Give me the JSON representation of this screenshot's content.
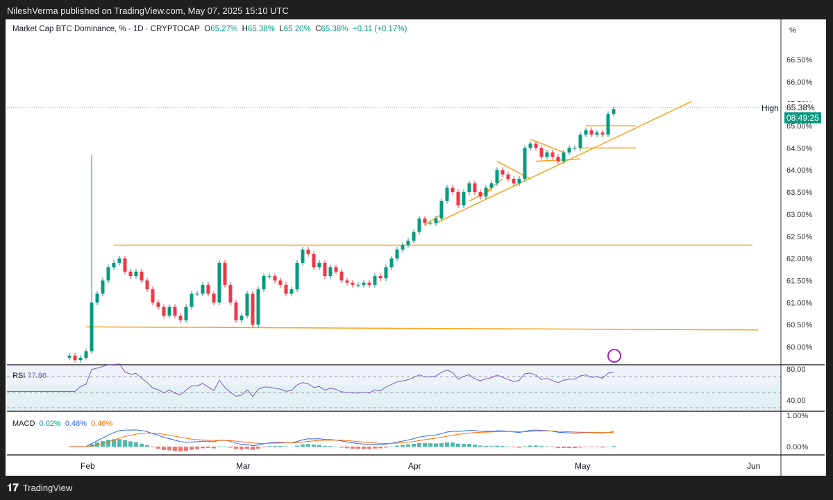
{
  "header": {
    "published": "NileshVerma published on TradingView.com, May 07, 2025 15:10 UTC"
  },
  "legend": {
    "symbol": "Market Cap BTC Dominance, % · 1D · CRYPTOCAP",
    "o_label": "O",
    "o": "65.27%",
    "h_label": "H",
    "h": "65.38%",
    "l_label": "L",
    "l": "65.20%",
    "c_label": "C",
    "c": "65.38%",
    "change": "+0.11 (+0.17%)"
  },
  "price_axis": {
    "unit": "%",
    "ticks": [
      "66.50%",
      "66.00%",
      "65.50%",
      "65.00%",
      "64.50%",
      "64.00%",
      "63.50%",
      "63.00%",
      "62.50%",
      "62.00%",
      "61.50%",
      "61.00%",
      "60.50%",
      "60.00%"
    ],
    "current": "65.38%",
    "countdown": "08:49:25",
    "high_label": "High"
  },
  "rsi": {
    "label": "RSI",
    "value": "77.86",
    "ticks": [
      "80.00",
      "40.00"
    ]
  },
  "macd": {
    "label": "MACD",
    "v1": "0.02%",
    "v2": "0.48%",
    "v3": "0.46%",
    "ticks": [
      "1.00%",
      "0.00%"
    ]
  },
  "time_axis": [
    "Feb",
    "Mar",
    "Apr",
    "May",
    "Jun"
  ],
  "footer": {
    "brand": "TradingView"
  },
  "colors": {
    "up": "#089981",
    "down": "#f23645",
    "line": "#f7a21b",
    "rsi": "#7e57c2",
    "macd": "#2962ff",
    "signal": "#ff6d00"
  },
  "chart_data": {
    "type": "candlestick",
    "start_date": "2025-01-29",
    "closes": [
      59.8,
      59.7,
      59.75,
      59.9,
      61.0,
      61.2,
      61.5,
      61.8,
      61.9,
      62.0,
      61.7,
      61.6,
      61.7,
      61.5,
      61.3,
      61.0,
      60.9,
      60.7,
      60.9,
      60.7,
      60.6,
      60.9,
      61.2,
      61.2,
      61.4,
      61.2,
      61.0,
      61.9,
      61.4,
      61.0,
      60.6,
      60.7,
      61.2,
      60.5,
      61.3,
      61.6,
      61.6,
      61.5,
      61.4,
      61.2,
      61.3,
      61.9,
      62.2,
      62.1,
      61.8,
      61.9,
      61.6,
      61.8,
      61.7,
      61.5,
      61.45,
      61.4,
      61.4,
      61.45,
      61.4,
      61.6,
      61.55,
      61.8,
      62.0,
      62.2,
      62.3,
      62.4,
      62.6,
      62.9,
      62.8,
      62.8,
      62.9,
      63.3,
      63.6,
      63.5,
      63.2,
      63.5,
      63.7,
      63.5,
      63.4,
      63.6,
      63.7,
      64.0,
      63.9,
      63.8,
      63.7,
      63.8,
      64.5,
      64.6,
      64.5,
      64.3,
      64.4,
      64.3,
      64.2,
      64.4,
      64.5,
      64.5,
      64.8,
      64.9,
      64.8,
      64.85,
      64.8,
      65.27,
      65.38
    ],
    "notable_high": {
      "day": 4,
      "price": 64.35
    },
    "ylim": [
      59.8,
      67.2
    ],
    "trendlines": [
      [
        8,
        62.3,
        123,
        62.3
      ],
      [
        3,
        60.45,
        124,
        60.38
      ],
      [
        66,
        62.8,
        112,
        65.55
      ],
      [
        64,
        62.75,
        67,
        63.0
      ],
      [
        72,
        63.3,
        76,
        63.55
      ],
      [
        75,
        63.5,
        78,
        63.8
      ],
      [
        77,
        64.2,
        83,
        63.8
      ],
      [
        83,
        64.7,
        89,
        64.4
      ],
      [
        84,
        64.2,
        92,
        64.25
      ],
      [
        92,
        64.5,
        102,
        64.5
      ],
      [
        93,
        65.0,
        102,
        65.0
      ]
    ]
  }
}
